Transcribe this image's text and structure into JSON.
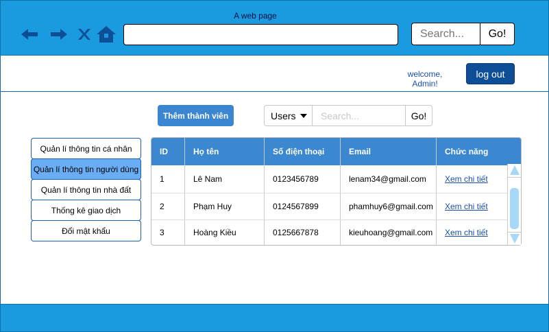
{
  "window": {
    "title": "A web page"
  },
  "chrome": {
    "url": "",
    "search_placeholder": "Search...",
    "go_label": "Go!",
    "icons": [
      "back-arrow-icon",
      "forward-arrow-icon",
      "close-icon",
      "home-icon"
    ]
  },
  "header": {
    "welcome_line1": "welcome,",
    "welcome_line2": "Admin!",
    "logout_label": "log out"
  },
  "toolbar": {
    "add_member_label": "Thêm thành viên",
    "filter_selected": "Users",
    "search_placeholder": "Search...",
    "go_label": "Go!"
  },
  "sidebar": {
    "items": [
      {
        "label": "Quản lí thông tin cá nhân",
        "active": false
      },
      {
        "label": "Quản lí thông tin người dùng",
        "active": true
      },
      {
        "label": "Quản lí thông tin nhà đất",
        "active": false
      },
      {
        "label": "Thống kê giao dịch",
        "active": false
      },
      {
        "label": "Đổi mật khẩu",
        "active": false
      }
    ]
  },
  "table": {
    "columns": [
      "ID",
      "Họ tên",
      "Số điện thoại",
      "Email",
      "Chức năng"
    ],
    "rows": [
      {
        "id": "1",
        "name": "Lê Nam",
        "phone": "0123456789",
        "email": "lenam34@gmail.com",
        "action": "Xem chi tiết"
      },
      {
        "id": "2",
        "name": "Phạm Huy",
        "phone": "0124567899",
        "email": "phamhuy6@gmail.com",
        "action": "Xem chi tiết"
      },
      {
        "id": "3",
        "name": "Hoàng Kiều",
        "phone": "0125667878",
        "email": "kieuhoang@gmail.com",
        "action": "Xem chi tiết"
      }
    ]
  },
  "colors": {
    "chrome_blue": "#1a9be0",
    "header_button": "#0d4e96",
    "table_header": "#3c88d0",
    "active_menu": "#69aef5",
    "link": "#1a4fa8"
  }
}
